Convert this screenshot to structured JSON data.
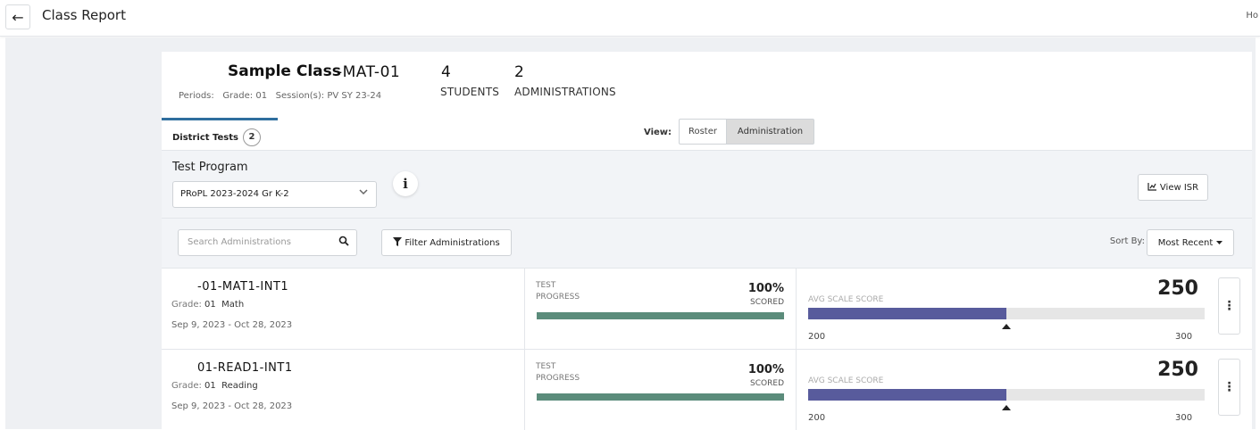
{
  "header": {
    "back_icon": "arrow-left-icon",
    "back_glyph": "←",
    "title": "Class Report",
    "right_truncated": "Ho"
  },
  "class_info": {
    "name": "Sample Class",
    "code": "-MAT-01",
    "periods_label": "Periods:",
    "grade": "Grade: 01",
    "sessions": "Session(s): PV SY 23-24",
    "students_count": "4",
    "students_label": "STUDENTS",
    "administrations_count": "2",
    "administrations_label": "ADMINISTRATIONS"
  },
  "tabs": [
    {
      "label": "District Tests",
      "badge": "2",
      "active": true
    }
  ],
  "view": {
    "label": "View:",
    "options": [
      "Roster",
      "Administration"
    ],
    "selected": "Administration"
  },
  "test_program": {
    "label": "Test Program",
    "selected": "PRoPL 2023-2024 Gr K-2",
    "info_glyph": "i",
    "view_isr_label": "View ISR",
    "view_isr_icon": "chart-icon"
  },
  "search": {
    "placeholder": "Search Administrations",
    "icon": "search-icon"
  },
  "filter": {
    "label": "Filter Administrations",
    "icon": "filter-icon"
  },
  "sort": {
    "label": "Sort By:",
    "selected": "Most Recent"
  },
  "administrations": [
    {
      "name": "-01-MAT1-INT1",
      "grade_label": "Grade:",
      "grade": "01",
      "subject": "Math",
      "dates": "Sep 9, 2023 - Oct 28, 2023",
      "progress_label_1": "TEST",
      "progress_label_2": "PROGRESS",
      "progress_pct_text": "100%",
      "progress_status": "SCORED",
      "progress_fraction": 1.0,
      "avg_label": "AVG SCALE SCORE",
      "avg_score": "250",
      "score_min": "200",
      "score_max": "300",
      "score_value": 250,
      "score_range": [
        200,
        300
      ],
      "bar_color": "#585b9c",
      "progress_color": "#5b8c7b"
    },
    {
      "name": "01-READ1-INT1",
      "grade_label": "Grade:",
      "grade": "01",
      "subject": "Reading",
      "dates": "Sep 9, 2023 - Oct 28, 2023",
      "progress_label_1": "TEST",
      "progress_label_2": "PROGRESS",
      "progress_pct_text": "100%",
      "progress_status": "SCORED",
      "progress_fraction": 1.0,
      "avg_label": "AVG SCALE SCORE",
      "avg_score": "250",
      "score_min": "200",
      "score_max": "300",
      "score_value": 250,
      "score_range": [
        200,
        300
      ],
      "bar_color": "#585b9c",
      "progress_color": "#5b8c7b"
    }
  ]
}
